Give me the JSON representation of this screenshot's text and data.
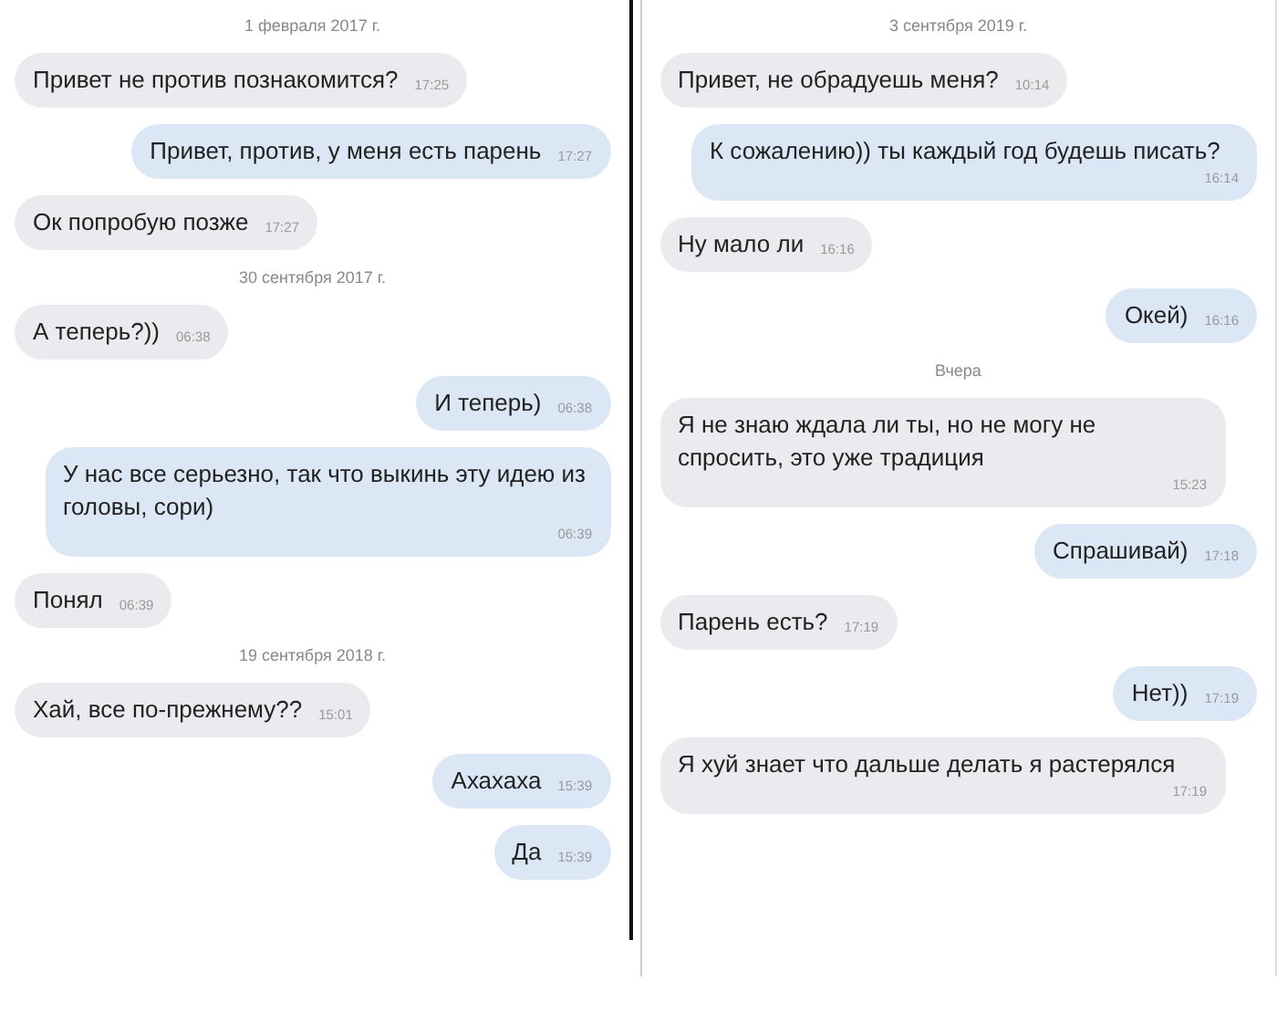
{
  "panels": [
    {
      "items": [
        {
          "kind": "date",
          "text": "1 февраля 2017 г."
        },
        {
          "kind": "message",
          "outgoing": false,
          "text": "Привет не против познакомится?",
          "time": "17:25"
        },
        {
          "kind": "message",
          "outgoing": true,
          "text": "Привет, против, у меня есть парень",
          "time": "17:27"
        },
        {
          "kind": "message",
          "outgoing": false,
          "text": "Ок попробую позже",
          "time": "17:27"
        },
        {
          "kind": "date",
          "text": "30 сентября 2017 г."
        },
        {
          "kind": "message",
          "outgoing": false,
          "text": "А теперь?))",
          "time": "06:38"
        },
        {
          "kind": "message",
          "outgoing": true,
          "text": "И теперь)",
          "time": "06:38"
        },
        {
          "kind": "message",
          "outgoing": true,
          "text": "У нас все серьезно, так что выкинь эту идею из головы, сори)",
          "time": "06:39"
        },
        {
          "kind": "message",
          "outgoing": false,
          "text": "Понял",
          "time": "06:39"
        },
        {
          "kind": "date",
          "text": "19 сентября 2018 г."
        },
        {
          "kind": "message",
          "outgoing": false,
          "text": "Хай, все по-прежнему??",
          "time": "15:01"
        },
        {
          "kind": "message",
          "outgoing": true,
          "text": "Ахахаха",
          "time": "15:39"
        },
        {
          "kind": "message",
          "outgoing": true,
          "text": "Да",
          "time": "15:39"
        }
      ]
    },
    {
      "items": [
        {
          "kind": "date",
          "text": "3 сентября 2019 г."
        },
        {
          "kind": "message",
          "outgoing": false,
          "text": "Привет, не обрадуешь меня?",
          "time": "10:14"
        },
        {
          "kind": "message",
          "outgoing": true,
          "text": "К сожалению)) ты каждый год будешь писать?",
          "time": "16:14"
        },
        {
          "kind": "message",
          "outgoing": false,
          "text": "Ну мало ли",
          "time": "16:16"
        },
        {
          "kind": "message",
          "outgoing": true,
          "text": "Окей)",
          "time": "16:16"
        },
        {
          "kind": "date",
          "text": "Вчера"
        },
        {
          "kind": "message",
          "outgoing": false,
          "text": "Я не знаю ждала ли ты, но не могу не спросить, это уже традиция",
          "time": "15:23"
        },
        {
          "kind": "message",
          "outgoing": true,
          "text": "Спрашивай)",
          "time": "17:18"
        },
        {
          "kind": "message",
          "outgoing": false,
          "text": "Парень есть?",
          "time": "17:19"
        },
        {
          "kind": "message",
          "outgoing": true,
          "text": "Нет))",
          "time": "17:19"
        },
        {
          "kind": "message",
          "outgoing": false,
          "text": "Я хуй знает что дальше делать я растерялся",
          "time": "17:19"
        }
      ]
    }
  ]
}
